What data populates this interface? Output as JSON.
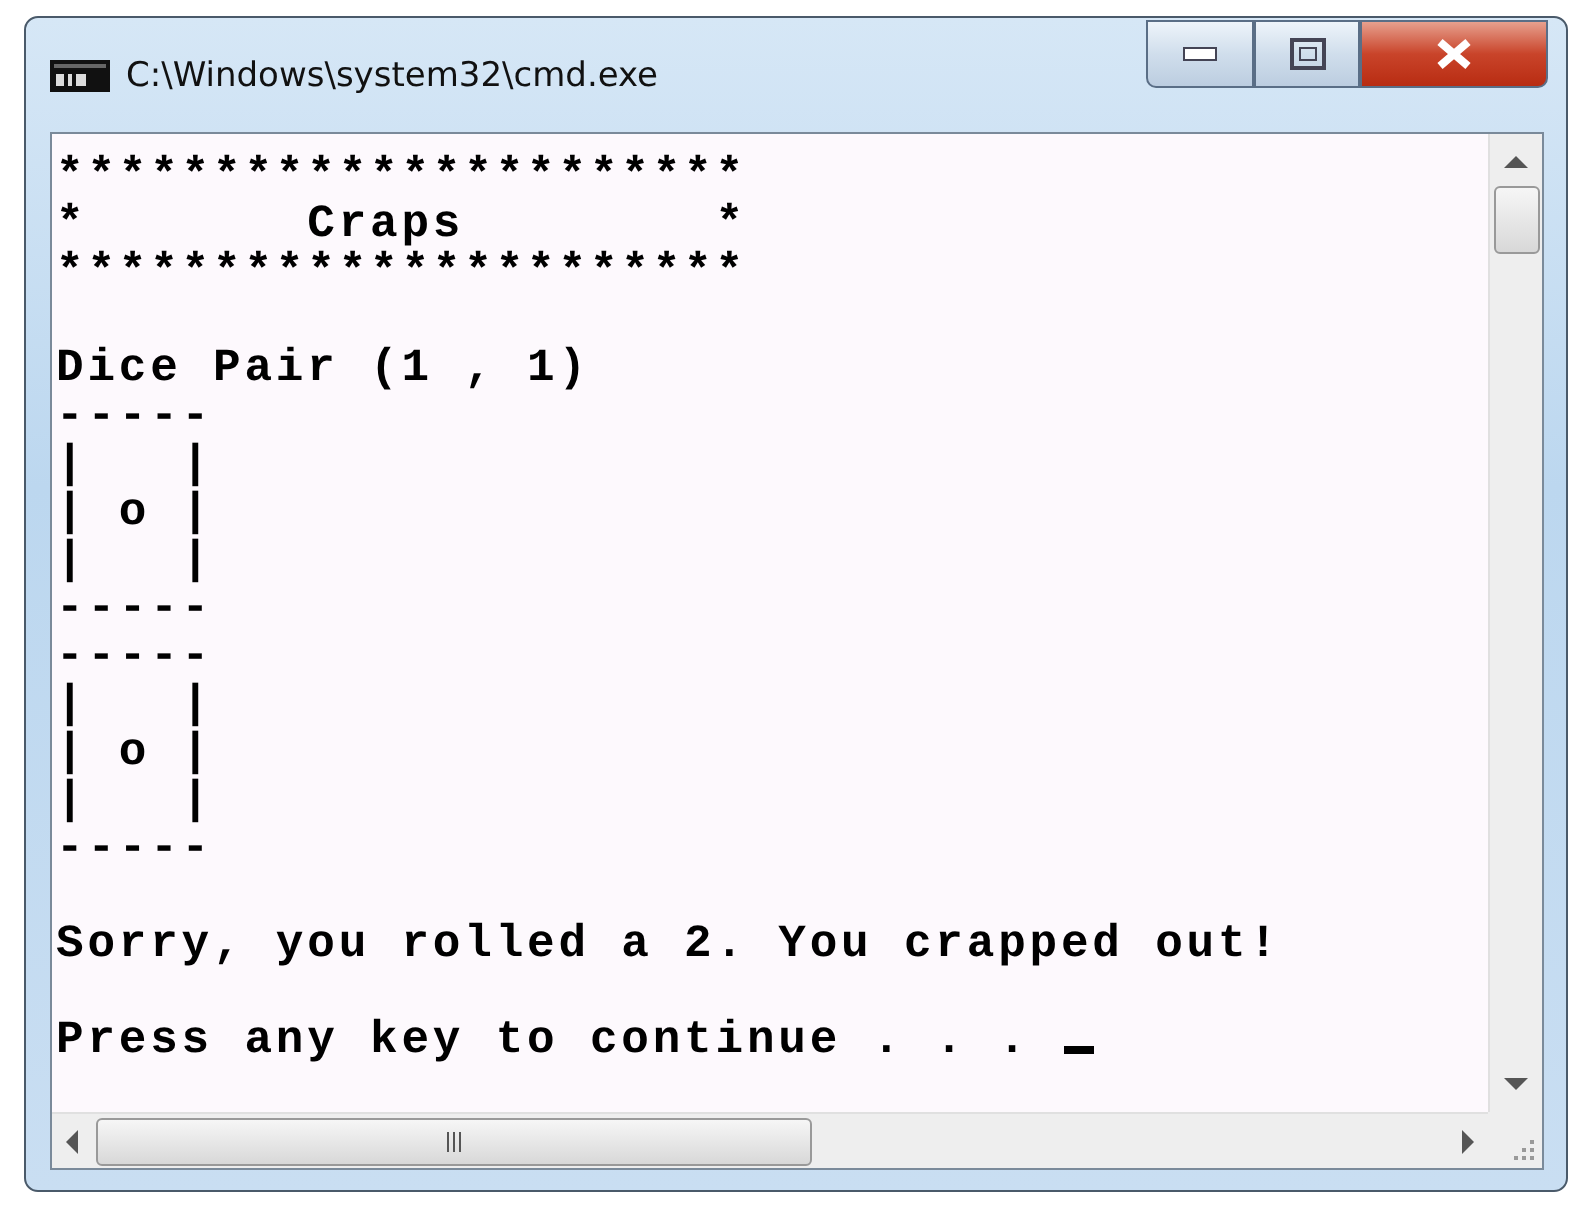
{
  "window": {
    "title": "C:\\Windows\\system32\\cmd.exe"
  },
  "console": {
    "cursor": true,
    "paragraphs": [
      [
        "**********************",
        "*       Craps        *",
        "**********************"
      ],
      [
        "Dice Pair (1 , 1)",
        "-----",
        "|   |",
        "| o |",
        "|   |",
        "-----",
        "-----",
        "|   |",
        "| o |",
        "|   |",
        "-----"
      ],
      [
        "Sorry, you rolled a 2. You crapped out!"
      ],
      [
        "Press any key to continue . . . "
      ]
    ]
  }
}
